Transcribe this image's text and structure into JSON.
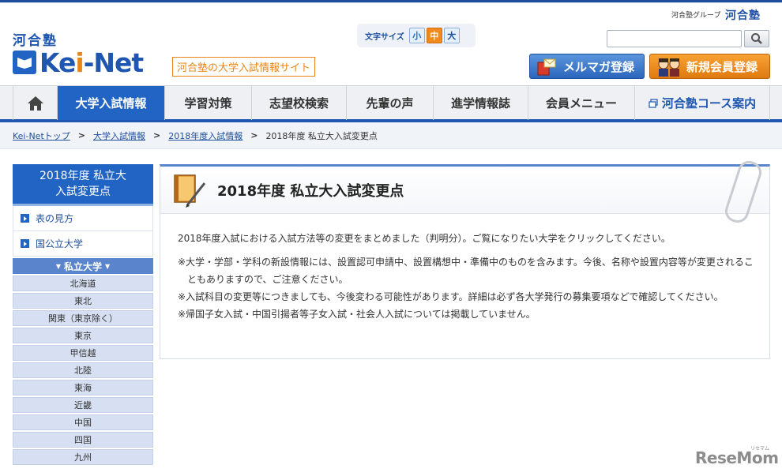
{
  "header": {
    "group_link": "河合塾グループ",
    "group_logo": "河合塾",
    "logo_kanji": "河合塾",
    "logo_text_pre": "Ke",
    "logo_text_dot": "i",
    "logo_text_post": "-Net",
    "tagline": "河合塾の大学入試情報サイト",
    "font_size_label": "文字サイズ",
    "font_sizes": [
      "小",
      "中",
      "大"
    ],
    "selected_font_size": "中",
    "search_value": "",
    "mail_button": "メルマガ登録",
    "register_button": "新規会員登録"
  },
  "nav": {
    "home_icon": "home-icon",
    "items": [
      "大学入試情報",
      "学習対策",
      "志望校検索",
      "先輩の声",
      "進学情報誌",
      "会員メニュー",
      "河合塾コース案内"
    ],
    "active": "大学入試情報"
  },
  "breadcrumb": {
    "items": [
      "Kei-Netトップ",
      "大学入試情報",
      "2018年度入試情報"
    ],
    "current": "2018年度 私立大入試変更点"
  },
  "sidebar": {
    "head": [
      "2018年度 私立大",
      "入試変更点"
    ],
    "links": [
      "表の見方",
      "国公立大学"
    ],
    "sub_head": "私立大学",
    "regions": [
      "北海道",
      "東北",
      "関東（東京除く）",
      "東京",
      "甲信越",
      "北陸",
      "東海",
      "近畿",
      "中国",
      "四国",
      "九州"
    ]
  },
  "content": {
    "title": "2018年度  私立大入試変更点",
    "intro": "2018年度入試における入試方法等の変更をまとめました（判明分）。ご覧になりたい大学をクリックしてください。",
    "notes": [
      "※大学・学部・学科の新設情報には、設置認可申請中、設置構想中・準備中のものを含みます。今後、名称や設置内容等が変更されることもありますので、ご注意ください。",
      "※入試科目の変更等につきましても、今後変わる可能性があります。詳細は必ず各大学発行の募集要項などで確認してください。",
      "※帰国子女入試・中国引揚者等子女入試・社会人入試については掲載していません。"
    ]
  },
  "watermark": {
    "text": "ReseMom",
    "sub": "リセマム"
  },
  "colors": {
    "brand_blue": "#2164c4",
    "accent_orange": "#e8861c"
  }
}
